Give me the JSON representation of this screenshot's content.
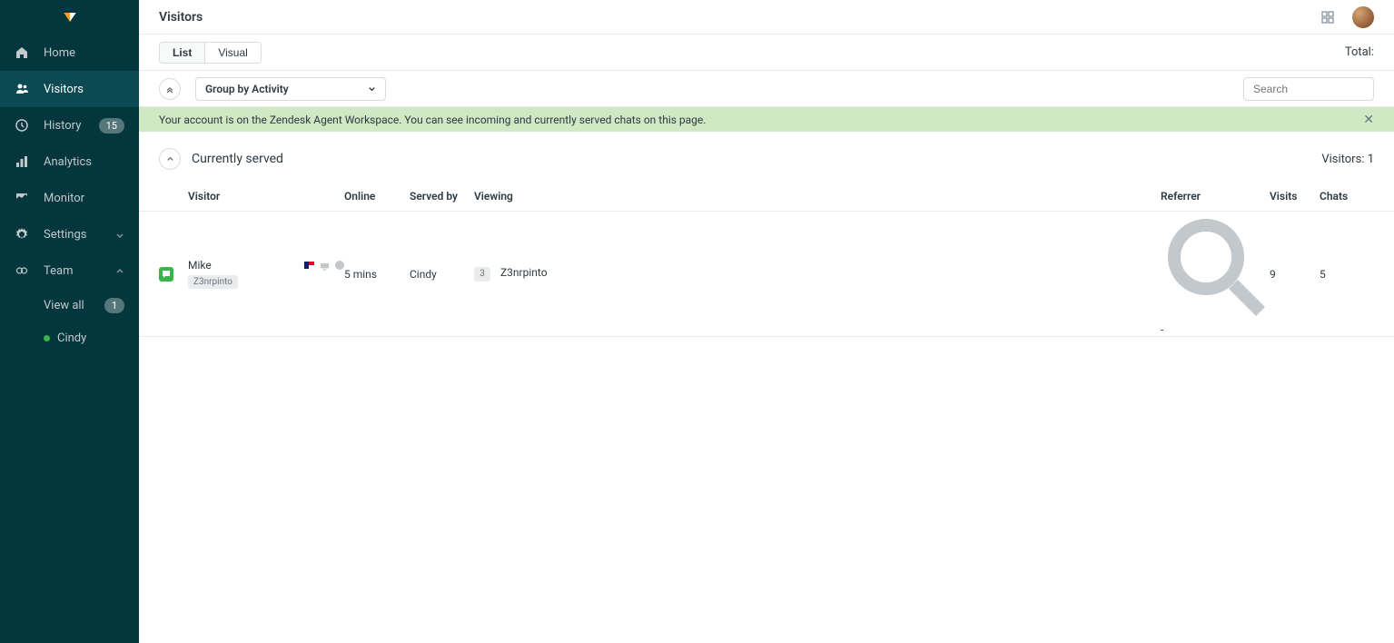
{
  "header": {
    "title": "Visitors"
  },
  "sidebar": {
    "items": [
      {
        "label": "Home"
      },
      {
        "label": "Visitors"
      },
      {
        "label": "History",
        "badge": "15"
      },
      {
        "label": "Analytics"
      },
      {
        "label": "Monitor"
      },
      {
        "label": "Settings"
      },
      {
        "label": "Team"
      }
    ],
    "team_sub": {
      "view_all": {
        "label": "View all",
        "badge": "1"
      },
      "members": [
        {
          "label": "Cindy"
        }
      ]
    }
  },
  "toolbar": {
    "tabs": {
      "list": "List",
      "visual": "Visual"
    },
    "total_label": "Total:"
  },
  "filter": {
    "group_by": "Group by Activity",
    "search_placeholder": "Search"
  },
  "notice": {
    "text": "Your account is on the Zendesk Agent Workspace. You can see incoming and currently served chats on this page."
  },
  "section": {
    "title": "Currently served",
    "count_label": "Visitors:",
    "count_value": "1"
  },
  "columns": {
    "visitor": "Visitor",
    "online": "Online",
    "served_by": "Served by",
    "viewing": "Viewing",
    "referrer": "Referrer",
    "visits": "Visits",
    "chats": "Chats"
  },
  "rows": [
    {
      "name": "Mike",
      "tag": "Z3nrpinto",
      "online": "5 mins",
      "served_by": "Cindy",
      "viewing_count": "3",
      "viewing_page": "Z3nrpinto",
      "referrer": "-",
      "visits": "9",
      "chats": "5"
    }
  ]
}
